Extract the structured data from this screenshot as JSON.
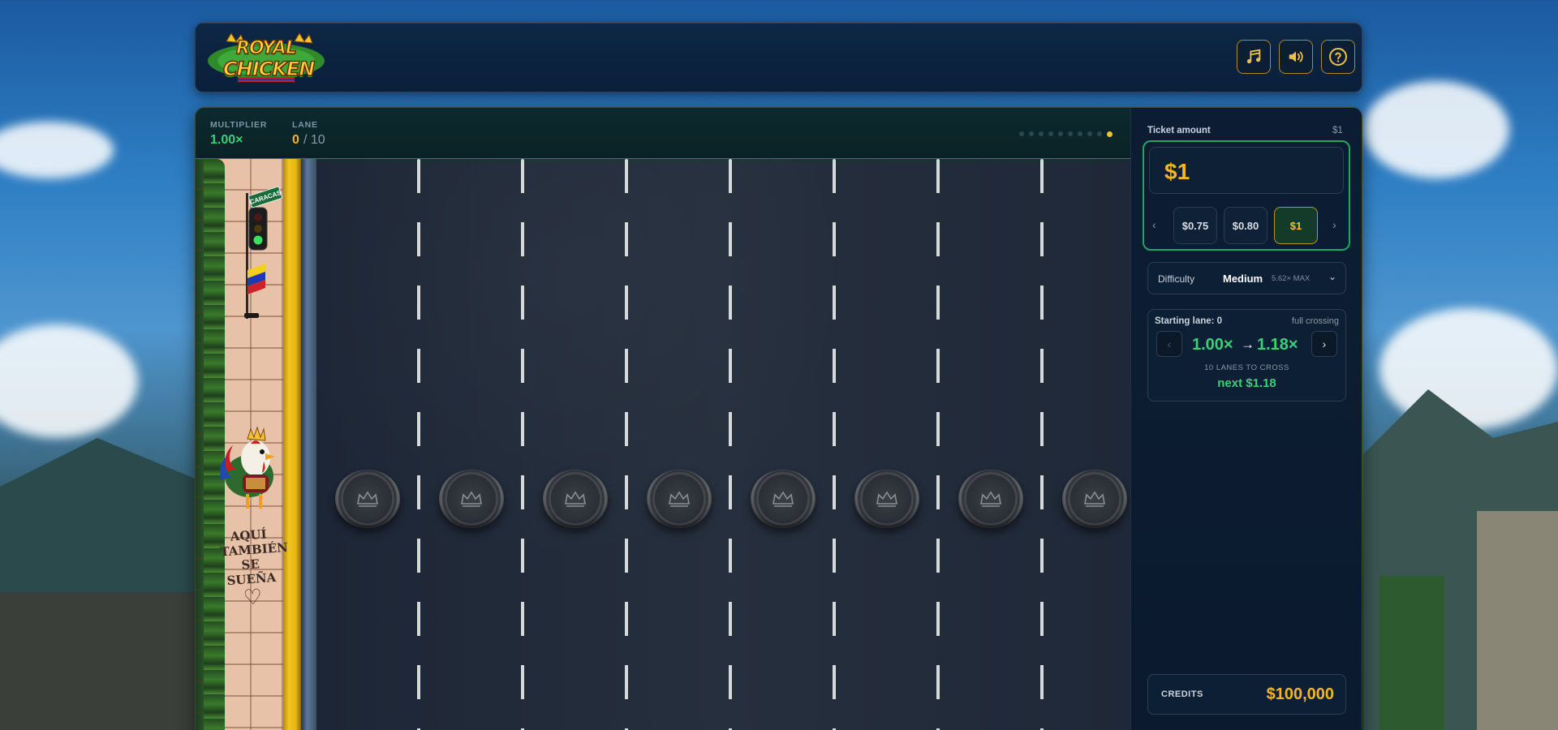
{
  "header": {
    "logo_line1": "ROYAL",
    "logo_line2": "CHICKEN",
    "buttons": [
      {
        "icon": "music-note-icon"
      },
      {
        "icon": "speaker-icon"
      },
      {
        "icon": "question-icon"
      }
    ]
  },
  "stats": {
    "multiplier_label": "MULTIPLIER",
    "multiplier_value": "1.00×",
    "lane_label": "LANE",
    "lane_current": "0",
    "lane_total": "/ 10",
    "progress_dots_total": 10,
    "progress_dot_active_index": 9
  },
  "scene": {
    "street_sign": "CARACAS",
    "sidewalk_text_lines": [
      "AQUÍ",
      "TAMBIÉN",
      "SE SUEÑA"
    ],
    "manholes": 8
  },
  "ticket": {
    "label": "Ticket amount",
    "label_value": "$1",
    "input_value": "$1",
    "chips": [
      "$0.75",
      "$0.80",
      "$1"
    ],
    "selected_chip": "$1"
  },
  "difficulty": {
    "label": "Difficulty",
    "value": "Medium",
    "max": "5.62× MAX"
  },
  "lane_card": {
    "starting_label": "Starting lane: 0",
    "mode": "full crossing",
    "from_mult": "1.00×",
    "to_mult": "1.18×",
    "lanes_text": "10 LANES TO CROSS",
    "next_text": "next $1.18"
  },
  "credits": {
    "label": "CREDITS",
    "value": "$100,000"
  },
  "colors": {
    "accent_green": "#3ccf7a",
    "accent_gold": "#f2b52a",
    "panel": "#0c1d33"
  }
}
